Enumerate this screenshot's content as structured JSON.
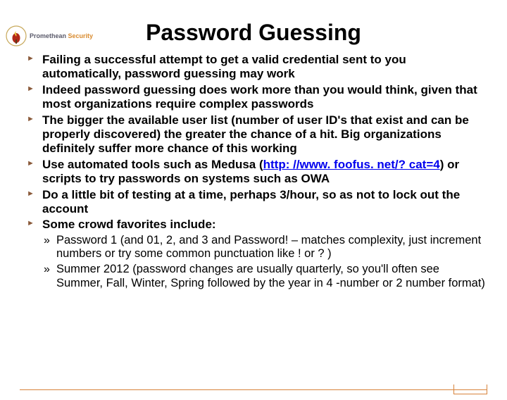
{
  "logo": {
    "brand_a": "Promethean",
    "brand_b": "Security"
  },
  "title": "Password Guessing",
  "bullets": [
    {
      "text": "Failing a successful attempt to get a valid credential sent to you automatically, password guessing may work"
    },
    {
      "text": "Indeed password guessing does work more than you would think, given that most organizations require complex passwords"
    },
    {
      "text": "The bigger the available user list (number of user ID's that exist and can be properly discovered) the greater the chance of a hit.  Big organizations definitely suffer more chance of this working"
    },
    {
      "pre": "Use automated tools such as Medusa (",
      "link": "http: //www. foofus. net/? cat=4",
      "post": ") or scripts to try passwords on systems such as OWA"
    },
    {
      "text": "Do a little bit of testing at a time, perhaps 3/hour, so as not to lock out the account"
    },
    {
      "text": "Some crowd favorites include:",
      "sub": [
        "Password 1  (and 01, 2, and 3 and Password! – matches complexity, just increment numbers or try some common punctuation like ! or ? )",
        "Summer 2012 (password changes are usually quarterly, so you'll often see Summer, Fall, Winter, Spring followed by the year in 4 -number or 2 number format)"
      ]
    }
  ]
}
